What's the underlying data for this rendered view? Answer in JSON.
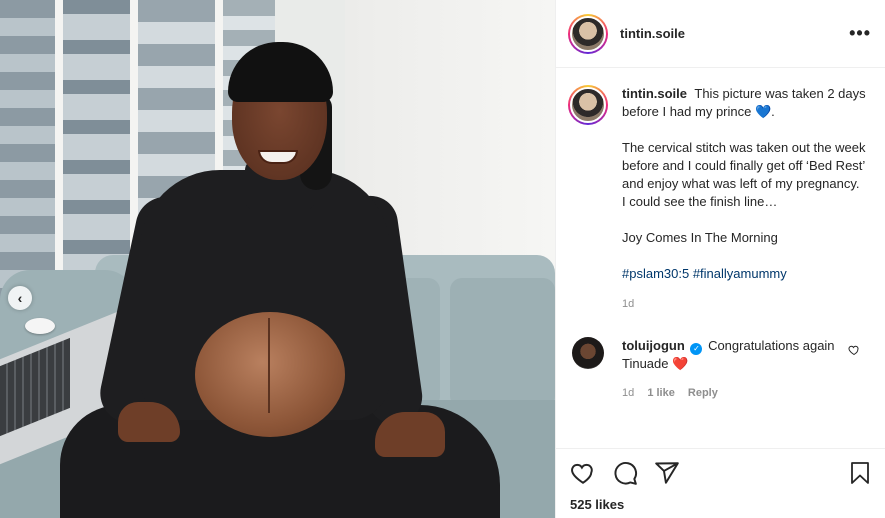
{
  "post": {
    "carousel_prev_glyph": "‹"
  },
  "header": {
    "username": "tintin.soile",
    "more_glyph": "•••"
  },
  "caption": {
    "username": "tintin.soile",
    "lines": [
      "This picture was taken 2 days before I had my prince",
      "",
      "The cervical stitch was taken out the week before and I could finally get off ‘Bed Rest’ and enjoy what was left of my pregnancy.",
      "I could see the finish line…",
      "",
      "Joy Comes In The Morning",
      ""
    ],
    "emoji": "💙",
    "hashtags": "#pslam30:5 #finallyamummy",
    "time": "1d"
  },
  "comment": {
    "username": "toluijogun",
    "text": "Congratulations again Tinuade",
    "emoji": "❤️",
    "time": "1d",
    "likes": "1 like",
    "reply": "Reply"
  },
  "likes": {
    "count_text": "525 likes"
  },
  "icons": [
    "heart-icon",
    "comment-icon",
    "share-icon",
    "bookmark-icon",
    "verified-icon",
    "comment-like-heart-icon",
    "more-icon",
    "chevron-left-icon"
  ],
  "colors": {
    "link": "#00376b",
    "verified": "#0095f6",
    "meta": "#8e8e8e",
    "border": "#efefef"
  }
}
